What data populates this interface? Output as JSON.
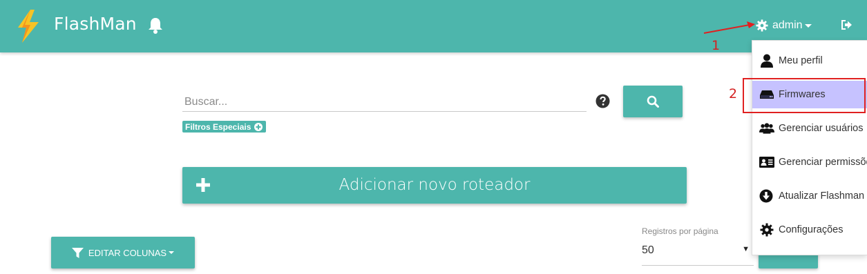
{
  "header": {
    "brand": "FlashMan",
    "user": "admin"
  },
  "search": {
    "placeholder": "Buscar...",
    "filter_badge": "Filtros Especiais"
  },
  "actions": {
    "add_router": "Adicionar novo roteador",
    "edit_columns": "EDITAR COLUNAS"
  },
  "pagination": {
    "label": "Registros por página",
    "value": "50"
  },
  "user_dropdown": {
    "items": [
      {
        "label": "Meu perfil",
        "icon": "user-icon"
      },
      {
        "label": "Firmwares",
        "icon": "hdd-icon",
        "active": true
      },
      {
        "label": "Gerenciar usuários",
        "icon": "users-icon"
      },
      {
        "label": "Gerenciar permissões",
        "icon": "id-card-icon"
      },
      {
        "label": "Atualizar Flashman",
        "icon": "download-circle-icon"
      },
      {
        "label": "Configurações",
        "icon": "cog-icon"
      }
    ]
  },
  "annotations": {
    "step1": "1",
    "step2": "2"
  },
  "colors": {
    "primary": "#4db6ac",
    "active_item": "#c6c2ff",
    "annotation": "#e02020"
  }
}
